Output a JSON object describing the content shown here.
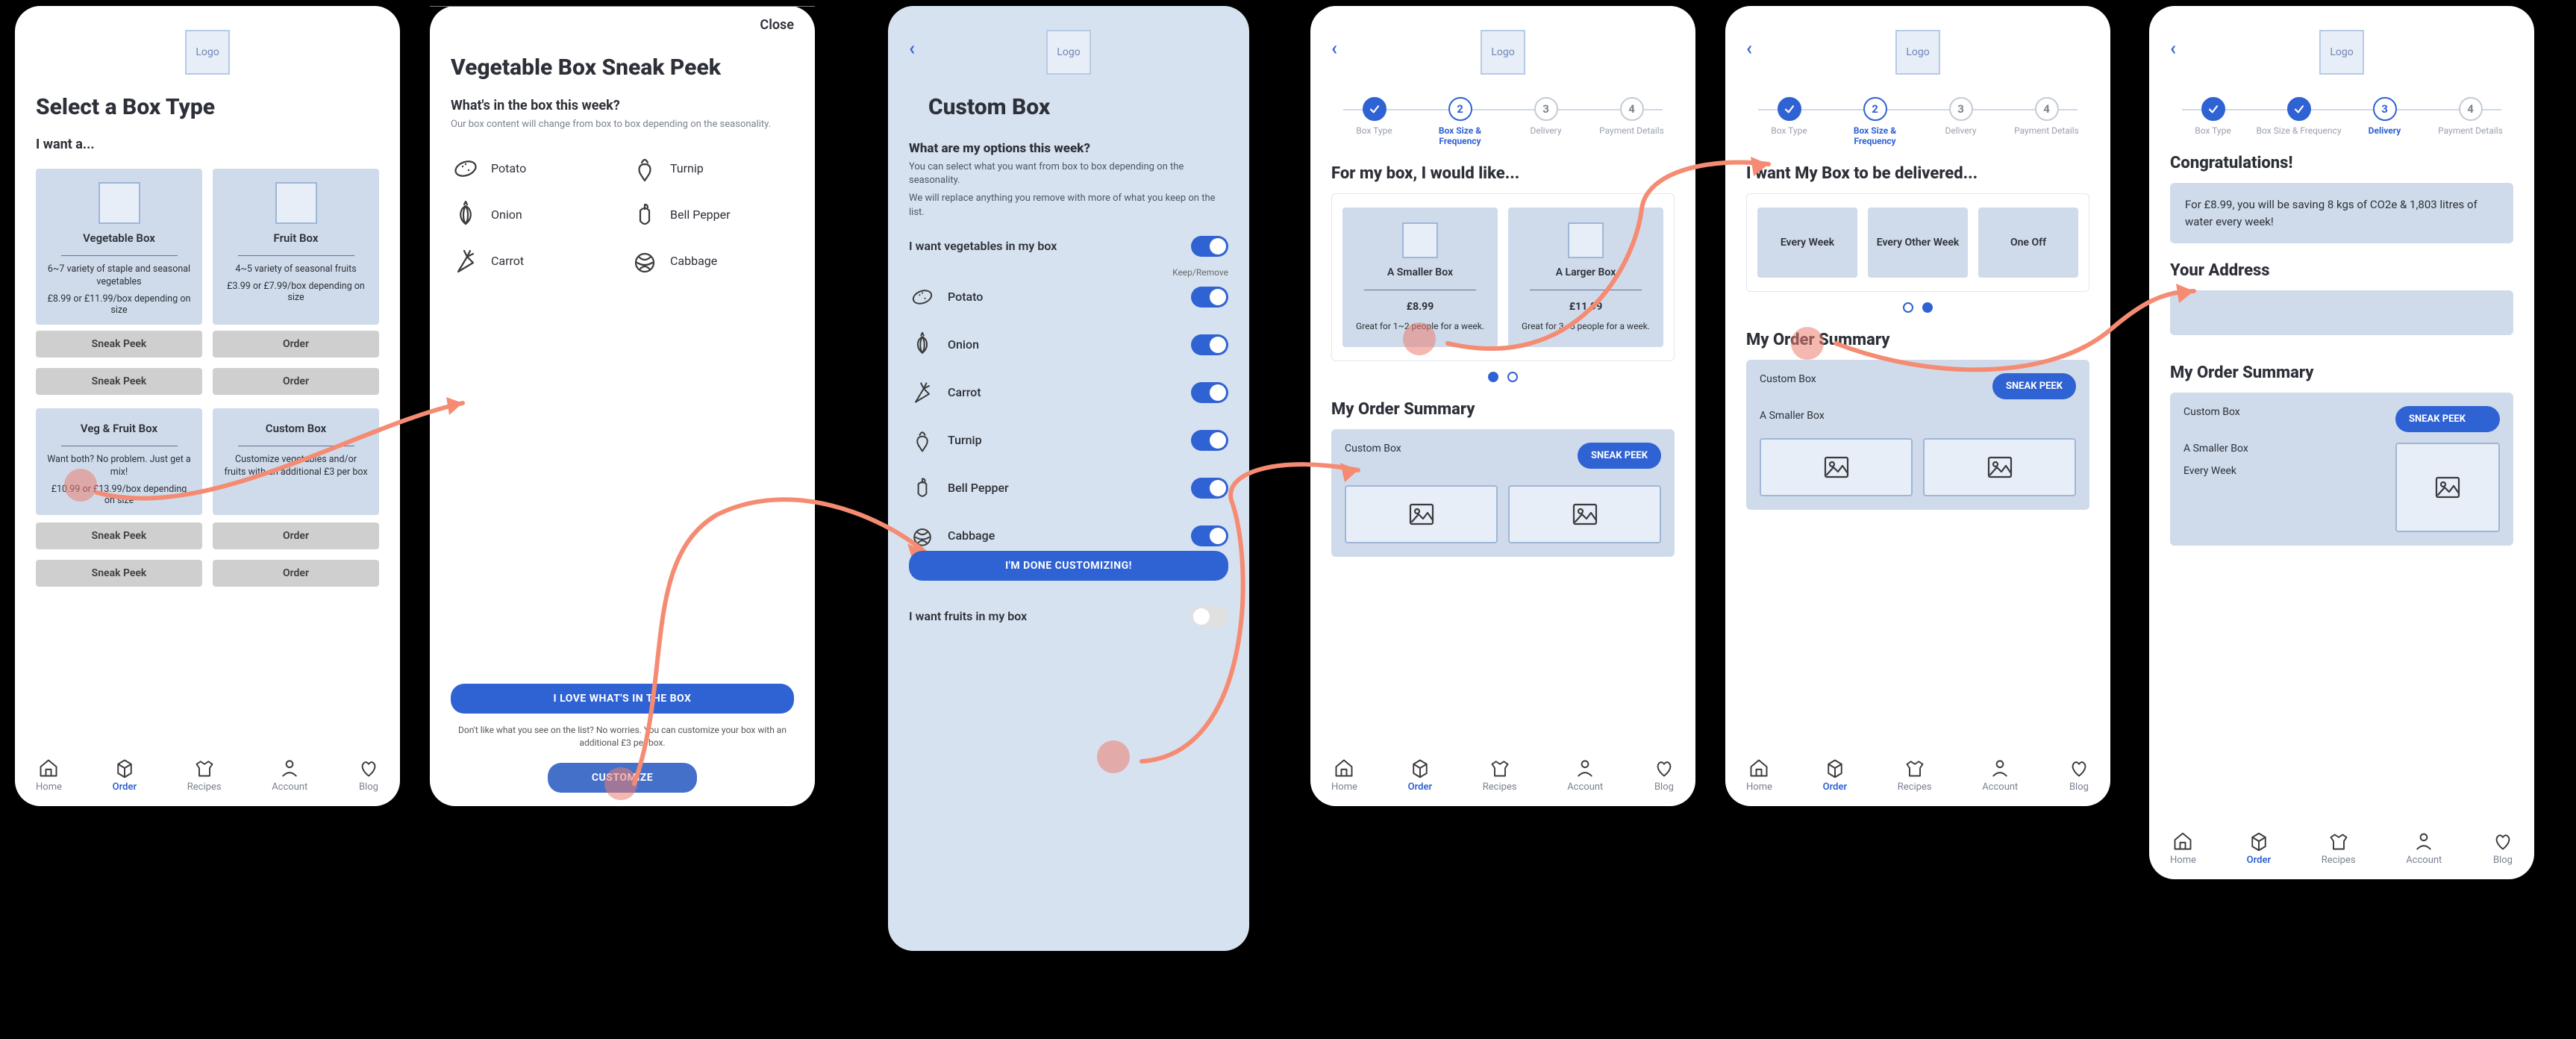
{
  "logo_text": "Logo",
  "nav": {
    "items": [
      {
        "label": "Home"
      },
      {
        "label": "Order"
      },
      {
        "label": "Recipes"
      },
      {
        "label": "Account"
      },
      {
        "label": "Blog"
      }
    ]
  },
  "s1": {
    "title": "Select a Box Type",
    "subtitle": "I want a...",
    "cards": [
      {
        "name": "Vegetable Box",
        "desc": "6~7 variety of staple and seasonal vegetables",
        "price": "£8.99 or £11.99/box depending on size"
      },
      {
        "name": "Fruit Box",
        "desc": "4~5 variety of seasonal fruits",
        "price": "£3.99 or £7.99/box depending on size"
      },
      {
        "name": "Veg & Fruit Box",
        "desc": "Want both? No problem. Just get a mix!",
        "price": "£10.99 or £13.99/box depending on size"
      },
      {
        "name": "Custom Box",
        "desc": "Customize vegetables and/or fruits with an additional £3 per box",
        "price": ""
      }
    ],
    "sneak_label": "Sneak Peek",
    "order_label": "Order"
  },
  "s2": {
    "close": "Close",
    "title": "Vegetable Box Sneak Peek",
    "question": "What's in the box this week?",
    "note": "Our box content will change from box to box depending on the seasonality.",
    "items": [
      "Potato",
      "Turnip",
      "Onion",
      "Bell Pepper",
      "Carrot",
      "Cabbage"
    ],
    "love_btn": "I LOVE WHAT'S IN THE BOX",
    "foot": "Don't like what you see on the list? No worries. You can customize your box with an additional £3 per box.",
    "customize_btn": "CUSTOMIZE"
  },
  "s3": {
    "title": "Custom Box",
    "question": "What are my options this week?",
    "note1": "You can select what you want from box to box depending on the seasonality.",
    "note2": "We will replace anything you remove with more of what you keep on the list.",
    "veg_toggle": "I want vegetables in my box",
    "kr": "Keep/Remove",
    "items": [
      "Potato",
      "Onion",
      "Carrot",
      "Turnip",
      "Bell Pepper",
      "Cabbage"
    ],
    "done_btn": "I'M DONE CUSTOMIZING!",
    "fruit_toggle": "I want fruits in my box"
  },
  "stepper": {
    "steps": [
      "Box Type",
      "Box Size & Frequency",
      "Delivery",
      "Payment Details"
    ],
    "nums": [
      "",
      "2",
      "3",
      "4"
    ]
  },
  "s4": {
    "title": "For my box, I would like...",
    "options": [
      {
        "name": "A Smaller Box",
        "price": "£8.99",
        "desc": "Great for 1~2 people for a week."
      },
      {
        "name": "A Larger Box",
        "price": "£11.99",
        "desc": "Great for 3~5 people for a week."
      }
    ],
    "summary_title": "My Order Summary",
    "summary_line": "Custom Box",
    "sneak": "SNEAK PEEK"
  },
  "s5": {
    "title": "I want My Box to be delivered...",
    "options": [
      "Every Week",
      "Every Other Week",
      "One Off"
    ],
    "summary_title": "My Order Summary",
    "summary_lines": [
      "Custom Box",
      "A Smaller Box"
    ],
    "sneak": "SNEAK PEEK"
  },
  "s6": {
    "congrats": "Congratulations!",
    "callout": "For £8.99, you will be saving 8 kgs of CO2e & 1,803 litres of water every week!",
    "addr_title": "Your Address",
    "summary_title": "My Order Summary",
    "summary_lines": [
      "Custom Box",
      "A Smaller Box",
      "Every Week"
    ],
    "sneak": "SNEAK PEEK"
  }
}
